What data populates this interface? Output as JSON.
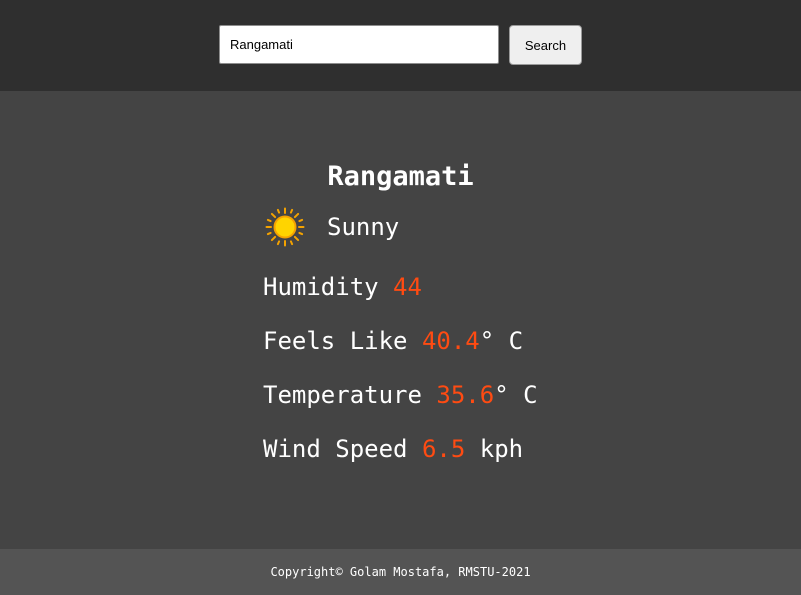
{
  "search": {
    "value": "Rangamati",
    "button_label": "Search"
  },
  "weather": {
    "city": "Rangamati",
    "condition": "Sunny",
    "condition_icon": "sun-icon",
    "humidity": {
      "label": "Humidity",
      "value": "44",
      "unit": ""
    },
    "feels_like": {
      "label": "Feels Like",
      "value": "40.4",
      "unit": "° C"
    },
    "temperature": {
      "label": "Temperature",
      "value": "35.6",
      "unit": "° C"
    },
    "wind_speed": {
      "label": "Wind Speed",
      "value": "6.5",
      "unit": "kph"
    }
  },
  "footer": {
    "copyright": "Copyright© Golam Mostafa, RMSTU-2021"
  },
  "colors": {
    "header_bg": "#2f2f2f",
    "main_bg": "#444444",
    "footer_bg": "#545454",
    "value_accent": "#ff4b12",
    "sun_fill": "#ffd400",
    "sun_rays": "#f5a300"
  }
}
